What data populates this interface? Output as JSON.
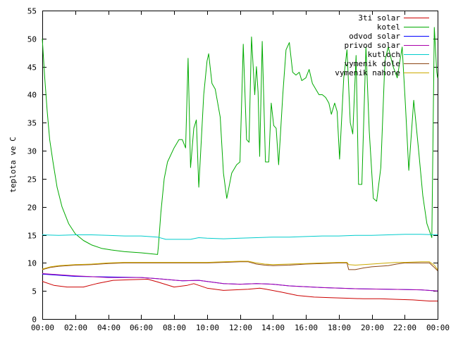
{
  "chart_data": {
    "type": "line",
    "title": "",
    "xlabel": "",
    "ylabel": "teplota ve C",
    "ylim": [
      0,
      55
    ],
    "xlim": [
      0,
      24
    ],
    "grid": false,
    "legend_position": "top-right",
    "x_ticks": [
      {
        "value": 0,
        "label": "00:00"
      },
      {
        "value": 2,
        "label": "02:00"
      },
      {
        "value": 4,
        "label": "04:00"
      },
      {
        "value": 6,
        "label": "06:00"
      },
      {
        "value": 8,
        "label": "08:00"
      },
      {
        "value": 10,
        "label": "10:00"
      },
      {
        "value": 12,
        "label": "12:00"
      },
      {
        "value": 14,
        "label": "14:00"
      },
      {
        "value": 16,
        "label": "16:00"
      },
      {
        "value": 18,
        "label": "18:00"
      },
      {
        "value": 20,
        "label": "20:00"
      },
      {
        "value": 22,
        "label": "22:00"
      },
      {
        "value": 24,
        "label": "00:00"
      }
    ],
    "y_ticks": [
      {
        "value": 0,
        "label": "0"
      },
      {
        "value": 5,
        "label": "5"
      },
      {
        "value": 10,
        "label": "10"
      },
      {
        "value": 15,
        "label": "15"
      },
      {
        "value": 20,
        "label": "20"
      },
      {
        "value": 25,
        "label": "25"
      },
      {
        "value": 30,
        "label": "30"
      },
      {
        "value": 35,
        "label": "35"
      },
      {
        "value": 40,
        "label": "40"
      },
      {
        "value": 45,
        "label": "45"
      },
      {
        "value": 50,
        "label": "50"
      },
      {
        "value": 55,
        "label": "55"
      }
    ],
    "series": [
      {
        "name": "3ti solar",
        "color": "#cc0000",
        "points": [
          [
            0,
            6.7
          ],
          [
            0.7,
            6.0
          ],
          [
            1.5,
            5.7
          ],
          [
            2.5,
            5.7
          ],
          [
            3.3,
            6.3
          ],
          [
            4.3,
            6.9
          ],
          [
            5.3,
            7.0
          ],
          [
            6.4,
            7.1
          ],
          [
            7.0,
            6.6
          ],
          [
            8.0,
            5.7
          ],
          [
            8.8,
            6.0
          ],
          [
            9.2,
            6.3
          ],
          [
            10.0,
            5.5
          ],
          [
            11.0,
            5.1
          ],
          [
            12.5,
            5.3
          ],
          [
            13.2,
            5.5
          ],
          [
            13.6,
            5.3
          ],
          [
            14.5,
            4.8
          ],
          [
            15.5,
            4.2
          ],
          [
            16.5,
            3.9
          ],
          [
            17.5,
            3.8
          ],
          [
            18.5,
            3.7
          ],
          [
            19.5,
            3.6
          ],
          [
            20.5,
            3.6
          ],
          [
            21.5,
            3.5
          ],
          [
            22.5,
            3.4
          ],
          [
            23.5,
            3.2
          ],
          [
            24,
            3.2
          ]
        ]
      },
      {
        "name": "kotel",
        "color": "#00aa00",
        "points": [
          [
            0,
            50.0
          ],
          [
            0.15,
            43.0
          ],
          [
            0.3,
            37.0
          ],
          [
            0.45,
            32.0
          ],
          [
            0.65,
            28.0
          ],
          [
            0.9,
            23.5
          ],
          [
            1.2,
            20.0
          ],
          [
            1.6,
            17.0
          ],
          [
            2.0,
            15.2
          ],
          [
            2.5,
            14.0
          ],
          [
            3.0,
            13.2
          ],
          [
            3.6,
            12.6
          ],
          [
            4.2,
            12.3
          ],
          [
            5.0,
            12.0
          ],
          [
            6.0,
            11.8
          ],
          [
            7.0,
            11.5
          ],
          [
            7.05,
            13.0
          ],
          [
            7.2,
            19.0
          ],
          [
            7.4,
            25.0
          ],
          [
            7.6,
            28.0
          ],
          [
            8.0,
            30.5
          ],
          [
            8.3,
            32.0
          ],
          [
            8.5,
            32.0
          ],
          [
            8.7,
            30.5
          ],
          [
            8.85,
            46.5
          ],
          [
            9.0,
            27.0
          ],
          [
            9.2,
            34.0
          ],
          [
            9.35,
            35.5
          ],
          [
            9.5,
            23.5
          ],
          [
            9.8,
            40.0
          ],
          [
            10.0,
            46.0
          ],
          [
            10.1,
            47.3
          ],
          [
            10.3,
            42.0
          ],
          [
            10.5,
            41.0
          ],
          [
            10.8,
            36.0
          ],
          [
            11.0,
            26.0
          ],
          [
            11.2,
            21.5
          ],
          [
            11.5,
            26.0
          ],
          [
            11.8,
            27.5
          ],
          [
            12.0,
            28.0
          ],
          [
            12.2,
            49.0
          ],
          [
            12.4,
            32.0
          ],
          [
            12.55,
            31.5
          ],
          [
            12.7,
            50.3
          ],
          [
            12.9,
            40.0
          ],
          [
            13.0,
            45.0
          ],
          [
            13.1,
            40.5
          ],
          [
            13.2,
            29.0
          ],
          [
            13.35,
            49.5
          ],
          [
            13.55,
            28.0
          ],
          [
            13.75,
            28.0
          ],
          [
            13.9,
            38.5
          ],
          [
            14.05,
            34.5
          ],
          [
            14.2,
            34.0
          ],
          [
            14.35,
            27.5
          ],
          [
            14.6,
            40.0
          ],
          [
            14.8,
            48.0
          ],
          [
            15.0,
            49.3
          ],
          [
            15.2,
            44.0
          ],
          [
            15.4,
            43.5
          ],
          [
            15.6,
            44.0
          ],
          [
            15.75,
            42.5
          ],
          [
            16.0,
            43.0
          ],
          [
            16.2,
            44.5
          ],
          [
            16.4,
            42.0
          ],
          [
            16.6,
            41.0
          ],
          [
            16.8,
            40.0
          ],
          [
            17.0,
            40.0
          ],
          [
            17.2,
            39.5
          ],
          [
            17.4,
            38.5
          ],
          [
            17.55,
            36.5
          ],
          [
            17.75,
            38.5
          ],
          [
            17.9,
            37.0
          ],
          [
            18.05,
            28.5
          ],
          [
            18.3,
            43.0
          ],
          [
            18.5,
            48.0
          ],
          [
            18.7,
            35.0
          ],
          [
            18.85,
            33.0
          ],
          [
            19.05,
            47.0
          ],
          [
            19.2,
            24.0
          ],
          [
            19.4,
            24.0
          ],
          [
            19.65,
            48.5
          ],
          [
            19.85,
            33.5
          ],
          [
            20.1,
            21.5
          ],
          [
            20.3,
            21.0
          ],
          [
            20.55,
            27.0
          ],
          [
            20.8,
            46.0
          ],
          [
            21.0,
            48.5
          ],
          [
            21.3,
            45.0
          ],
          [
            21.55,
            43.0
          ],
          [
            21.85,
            48.5
          ],
          [
            22.05,
            38.0
          ],
          [
            22.25,
            26.5
          ],
          [
            22.55,
            39.0
          ],
          [
            22.85,
            30.0
          ],
          [
            23.1,
            22.0
          ],
          [
            23.35,
            17.0
          ],
          [
            23.65,
            14.5
          ],
          [
            23.8,
            52.0
          ],
          [
            23.95,
            44.0
          ],
          [
            24,
            43.0
          ]
        ]
      },
      {
        "name": "odvod solar",
        "color": "#0000ff",
        "points": [
          [
            0,
            8.0
          ],
          [
            2,
            7.6
          ],
          [
            4,
            7.5
          ],
          [
            6,
            7.4
          ],
          [
            7,
            7.2
          ],
          [
            8.5,
            6.8
          ],
          [
            9.5,
            6.9
          ],
          [
            11,
            6.3
          ],
          [
            12,
            6.2
          ],
          [
            13,
            6.3
          ],
          [
            14,
            6.2
          ],
          [
            15,
            5.9
          ],
          [
            17,
            5.6
          ],
          [
            19,
            5.4
          ],
          [
            21,
            5.3
          ],
          [
            23,
            5.2
          ],
          [
            24,
            5.0
          ]
        ]
      },
      {
        "name": "privod solar",
        "color": "#aa00aa",
        "points": [
          [
            0,
            8.1
          ],
          [
            2,
            7.7
          ],
          [
            4,
            7.4
          ],
          [
            6,
            7.4
          ],
          [
            7,
            7.2
          ],
          [
            8.5,
            6.8
          ],
          [
            9.5,
            6.9
          ],
          [
            11,
            6.3
          ],
          [
            12,
            6.2
          ],
          [
            13,
            6.3
          ],
          [
            14,
            6.2
          ],
          [
            15,
            5.9
          ],
          [
            17,
            5.6
          ],
          [
            19,
            5.4
          ],
          [
            21,
            5.3
          ],
          [
            23,
            5.2
          ],
          [
            24,
            5.0
          ]
        ]
      },
      {
        "name": "kutloch",
        "color": "#00cccc",
        "points": [
          [
            0,
            15.0
          ],
          [
            1,
            14.9
          ],
          [
            2,
            15.0
          ],
          [
            3,
            15.0
          ],
          [
            4,
            14.9
          ],
          [
            5,
            14.8
          ],
          [
            6,
            14.8
          ],
          [
            7,
            14.6
          ],
          [
            7.5,
            14.2
          ],
          [
            8,
            14.2
          ],
          [
            9,
            14.2
          ],
          [
            9.5,
            14.5
          ],
          [
            10,
            14.4
          ],
          [
            11,
            14.3
          ],
          [
            12,
            14.4
          ],
          [
            13,
            14.5
          ],
          [
            14,
            14.6
          ],
          [
            15,
            14.6
          ],
          [
            16,
            14.7
          ],
          [
            17,
            14.8
          ],
          [
            18,
            14.8
          ],
          [
            19,
            14.9
          ],
          [
            20,
            14.9
          ],
          [
            21,
            15.0
          ],
          [
            22,
            15.1
          ],
          [
            23,
            15.1
          ],
          [
            24,
            15.0
          ]
        ]
      },
      {
        "name": "vymenik dole",
        "color": "#8b4513",
        "points": [
          [
            0,
            8.8
          ],
          [
            0.5,
            9.2
          ],
          [
            1,
            9.4
          ],
          [
            2,
            9.6
          ],
          [
            3,
            9.7
          ],
          [
            4,
            9.9
          ],
          [
            5,
            10.0
          ],
          [
            6,
            10.0
          ],
          [
            7,
            10.0
          ],
          [
            8,
            10.0
          ],
          [
            9,
            10.0
          ],
          [
            10,
            10.0
          ],
          [
            11,
            10.1
          ],
          [
            12,
            10.2
          ],
          [
            12.5,
            10.2
          ],
          [
            13,
            9.8
          ],
          [
            13.5,
            9.6
          ],
          [
            14,
            9.5
          ],
          [
            15,
            9.6
          ],
          [
            16,
            9.8
          ],
          [
            17,
            9.9
          ],
          [
            18,
            10.0
          ],
          [
            18.5,
            10.0
          ],
          [
            18.6,
            8.8
          ],
          [
            19,
            8.8
          ],
          [
            19.5,
            9.1
          ],
          [
            20,
            9.3
          ],
          [
            21,
            9.5
          ],
          [
            21.5,
            9.8
          ],
          [
            22,
            10.0
          ],
          [
            23,
            10.0
          ],
          [
            23.5,
            10.0
          ],
          [
            23.8,
            9.2
          ],
          [
            24,
            8.6
          ]
        ]
      },
      {
        "name": "vymenik nahore",
        "color": "#ccaa00",
        "points": [
          [
            0,
            8.9
          ],
          [
            0.5,
            9.3
          ],
          [
            1,
            9.5
          ],
          [
            2,
            9.7
          ],
          [
            3,
            9.8
          ],
          [
            4,
            10.0
          ],
          [
            5,
            10.1
          ],
          [
            6,
            10.1
          ],
          [
            7,
            10.1
          ],
          [
            8,
            10.1
          ],
          [
            9,
            10.1
          ],
          [
            10,
            10.1
          ],
          [
            11,
            10.2
          ],
          [
            12,
            10.3
          ],
          [
            12.5,
            10.3
          ],
          [
            13,
            10.0
          ],
          [
            13.5,
            9.8
          ],
          [
            14,
            9.7
          ],
          [
            15,
            9.8
          ],
          [
            16,
            9.9
          ],
          [
            17,
            10.0
          ],
          [
            18,
            10.1
          ],
          [
            18.5,
            10.1
          ],
          [
            18.6,
            9.7
          ],
          [
            19,
            9.6
          ],
          [
            19.5,
            9.7
          ],
          [
            20,
            9.8
          ],
          [
            21,
            10.0
          ],
          [
            21.5,
            10.1
          ],
          [
            22,
            10.1
          ],
          [
            23,
            10.2
          ],
          [
            23.5,
            10.2
          ],
          [
            23.8,
            9.6
          ],
          [
            24,
            8.8
          ]
        ]
      }
    ]
  }
}
